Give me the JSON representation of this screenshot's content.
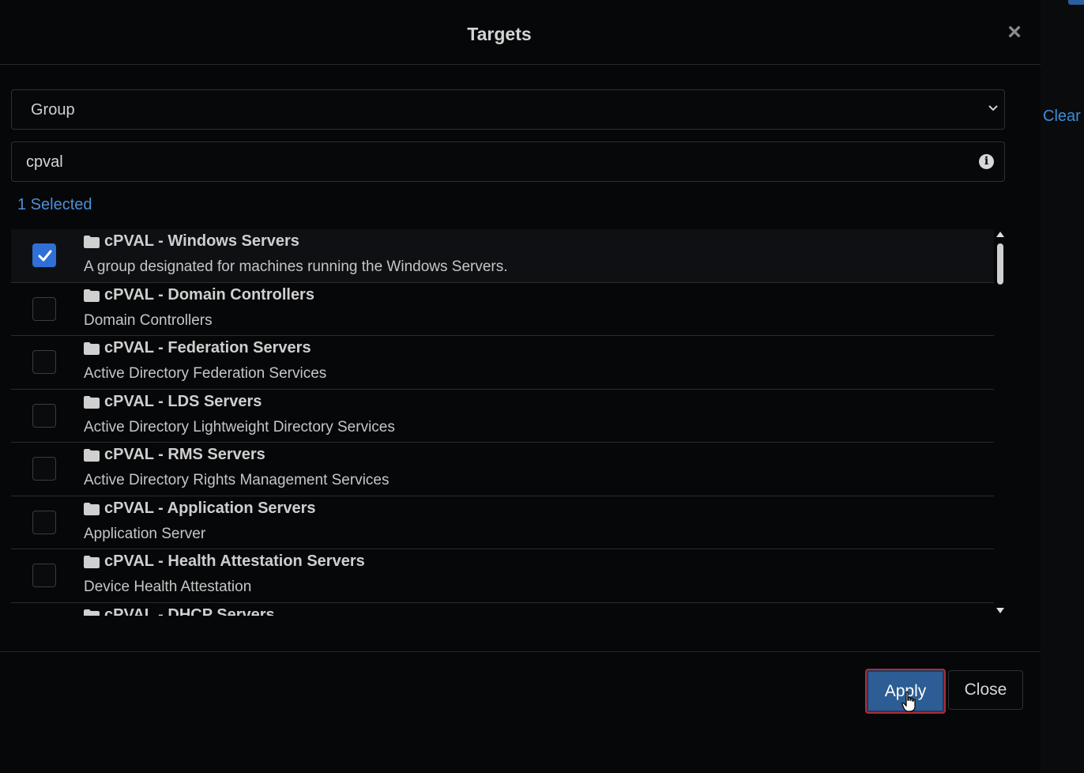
{
  "background": {
    "clear_link": "Clear"
  },
  "modal": {
    "title": "Targets",
    "close_symbol": "×"
  },
  "filter": {
    "type_select": {
      "value": "Group"
    },
    "search": {
      "value": "cpval"
    }
  },
  "selected_count": "1 Selected",
  "groups": [
    {
      "title": "cPVAL - Windows Servers",
      "description": "A group designated for machines running the Windows Servers.",
      "checked": true
    },
    {
      "title": "cPVAL - Domain Controllers",
      "description": "Domain Controllers",
      "checked": false
    },
    {
      "title": "cPVAL - Federation Servers",
      "description": "Active Directory Federation Services",
      "checked": false
    },
    {
      "title": "cPVAL - LDS Servers",
      "description": "Active Directory Lightweight Directory Services",
      "checked": false
    },
    {
      "title": "cPVAL - RMS Servers",
      "description": "Active Directory Rights Management Services",
      "checked": false
    },
    {
      "title": "cPVAL - Application Servers",
      "description": "Application Server",
      "checked": false
    },
    {
      "title": "cPVAL - Health Attestation Servers",
      "description": "Device Health Attestation",
      "checked": false
    },
    {
      "title": "cPVAL - DHCP Servers",
      "description": "",
      "checked": false
    }
  ],
  "footer": {
    "apply_label": "Apply",
    "close_label": "Close"
  },
  "colors": {
    "accent": "#2f6fd6",
    "link": "#4a90d9",
    "apply_bg": "#2c5d94",
    "apply_border": "#b52a32"
  },
  "icons": {
    "info": "info-icon",
    "folder": "folder-icon",
    "close": "close-icon",
    "caret": "chevron-down-icon",
    "check": "checkmark-icon"
  }
}
